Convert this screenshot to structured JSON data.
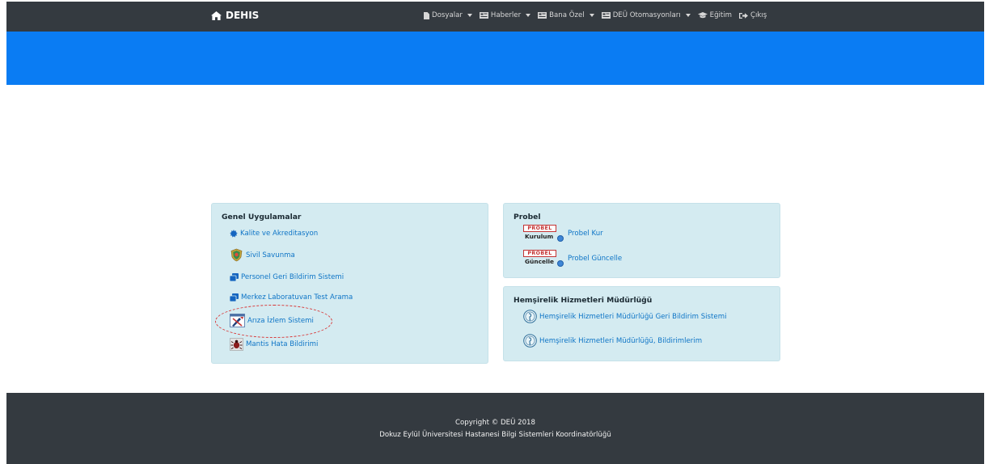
{
  "navbar": {
    "brand": "DEHIS",
    "menu": [
      {
        "label": "Dosyalar",
        "icon": "file-icon",
        "dropdown": true
      },
      {
        "label": "Haberler",
        "icon": "newspaper-icon",
        "dropdown": true
      },
      {
        "label": "Bana Özel",
        "icon": "newspaper-icon",
        "dropdown": true
      },
      {
        "label": "DEÜ Otomasyonları",
        "icon": "newspaper-icon",
        "dropdown": true
      },
      {
        "label": "Eğitim",
        "icon": "graduation-cap-icon",
        "dropdown": false
      },
      {
        "label": "Çıkış",
        "icon": "sign-out-icon",
        "dropdown": false
      }
    ]
  },
  "genel": {
    "title": "Genel Uygulamalar",
    "links": [
      {
        "label": "Kalite ve Akreditasyon",
        "icon": "certificate-icon"
      },
      {
        "label": "Sivil Savunma",
        "icon": "civil-defense-emblem-icon"
      },
      {
        "label": "Personel Geri Bildirim Sistemi",
        "icon": "clone-icon"
      },
      {
        "label": "Merkez Laboratuvan Test Arama",
        "icon": "clone-icon"
      },
      {
        "label": "Arıza İzlem Sistemi",
        "icon": "tools-icon"
      },
      {
        "label": "Mantis Hata Bildirimi",
        "icon": "bug-icon"
      }
    ]
  },
  "probel": {
    "title": "Probel",
    "links": [
      {
        "label": "Probel Kur",
        "logo_top": "PROBEL",
        "logo_bottom": "Kurulum"
      },
      {
        "label": "Probel Güncelle",
        "logo_top": "PROBEL",
        "logo_bottom": "Güncelle"
      }
    ]
  },
  "hemsirelik": {
    "title": "Hemşirelik Hizmetleri Müdürlüğü",
    "links": [
      {
        "label": "Hemşirelik Hizmetleri Müdürlüğü Geri Bildirim Sistemi",
        "icon": "nurse-emblem-icon"
      },
      {
        "label": "Hemşirelik Hizmetleri Müdürlüğü, Bildirimlerim",
        "icon": "nurse-emblem-icon"
      }
    ]
  },
  "footer": {
    "copyright": "Copyright © DEÜ 2018",
    "org": "Dokuz Eylül Üniversitesi Hastanesi Bilgi Sistemleri Koordinatörlüğü"
  },
  "colors": {
    "navbar": "#343a40",
    "banner": "#0a7cf3",
    "card": "#d4ebf1",
    "link": "#0d74c6",
    "highlight": "#d93838"
  }
}
